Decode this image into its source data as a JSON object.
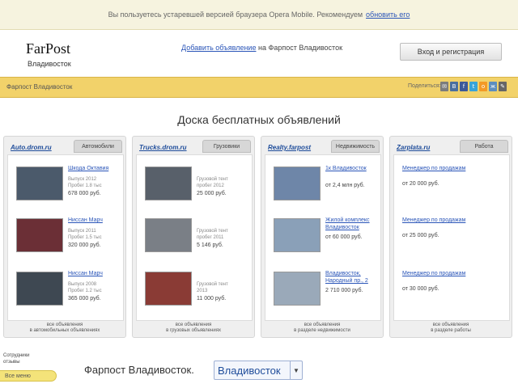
{
  "notice": {
    "text": "Вы пользуетесь устаревшей версией браузера Opera Mobile. Рекомендуем",
    "link": "обновить его"
  },
  "header": {
    "logo": "FarPost",
    "city": "Владивосток",
    "add_link": "Добавить объявление",
    "add_suffix": "на Фарпост Владивосток",
    "login_button": "Вход и регистрация"
  },
  "crumbbar": {
    "crumb": "Фарпост Владивосток",
    "share_label": "Поделиться:",
    "icons": [
      {
        "name": "mail-icon",
        "glyph": "✉",
        "color": "#7c7c7c"
      },
      {
        "name": "vk-icon",
        "glyph": "В",
        "color": "#4a6f9e"
      },
      {
        "name": "facebook-icon",
        "glyph": "f",
        "color": "#3b5998"
      },
      {
        "name": "twitter-icon",
        "glyph": "t",
        "color": "#39a4d9"
      },
      {
        "name": "odnoklassniki-icon",
        "glyph": "о",
        "color": "#f39a26"
      },
      {
        "name": "livejournal-icon",
        "glyph": "ж",
        "color": "#5d8ebf"
      },
      {
        "name": "pencil-icon",
        "glyph": "✎",
        "color": "#666"
      }
    ]
  },
  "main": {
    "title": "Доска бесплатных объявлений"
  },
  "boards": [
    {
      "logo": "Auto.drom.ru",
      "tab": "Автомобили",
      "footer": "все объявления\nв автомобильных объявлениях",
      "items": [
        {
          "title": "Шкода Октавия",
          "desc": "Выпуск 2012\nПробег 1.8 тыс",
          "price": "678 000 руб.",
          "thumb": "#4b5a6b"
        },
        {
          "title": "Ниссан Марч",
          "desc": "Выпуск 2011\nПробег 1.5 тыс",
          "price": "320 000 руб.",
          "thumb": "#6b2f36"
        },
        {
          "title": "Ниссан Марч",
          "desc": "Выпуск 2008\nПробег 1.2 тыс",
          "price": "365 000 руб.",
          "thumb": "#3e4852"
        }
      ]
    },
    {
      "logo": "Trucks.drom.ru",
      "tab": "Грузовики",
      "footer": "все объявления\nв грузовых объявлениях",
      "items": [
        {
          "title": "",
          "desc": "Грузовой тент\nпробег 2012",
          "price": "25 000 руб.",
          "thumb": "#58606a"
        },
        {
          "title": "",
          "desc": "Грузовой тент\nпробег 2011",
          "price": "5 146 руб.",
          "thumb": "#7a7f86"
        },
        {
          "title": "",
          "desc": "Грузовой тент\n2013",
          "price": "11 000 руб.",
          "thumb": "#8a3b35"
        }
      ]
    },
    {
      "logo": "Realty.farpost",
      "tab": "Недвижимость",
      "footer": "все объявления\nв разделе недвижимости",
      "items": [
        {
          "title": "1к Владивосток",
          "desc": "",
          "price": "от 2,4 млн руб.",
          "thumb": "#6e86a8"
        },
        {
          "title": "Жилой комплекс Владивосток",
          "desc": "",
          "price": "от 60 000 руб.",
          "thumb": "#8aa0b8"
        },
        {
          "title": "Владивосток, Народный пр., 2",
          "desc": "",
          "price": "2 710 000 руб.",
          "thumb": "#9aa9b9"
        }
      ]
    },
    {
      "logo": "Zarplata.ru",
      "tab": "Работа",
      "footer": "все объявления\nв разделе работы",
      "items": [
        {
          "title": "Менеджер по продажам",
          "desc": "",
          "price": "от 20 000 руб.",
          "thumb": ""
        },
        {
          "title": "Менеджер по продажам",
          "desc": "",
          "price": "от 25 000 руб.",
          "thumb": ""
        },
        {
          "title": "Менеджер по продажам",
          "desc": "",
          "price": "от 30 000 руб.",
          "thumb": ""
        }
      ]
    }
  ],
  "left_note": "Сотрудники\nотзывы",
  "side_tab": "Все меню",
  "bottom": {
    "label": "Фарпост Владивосток.",
    "city_select": "Владивосток"
  }
}
